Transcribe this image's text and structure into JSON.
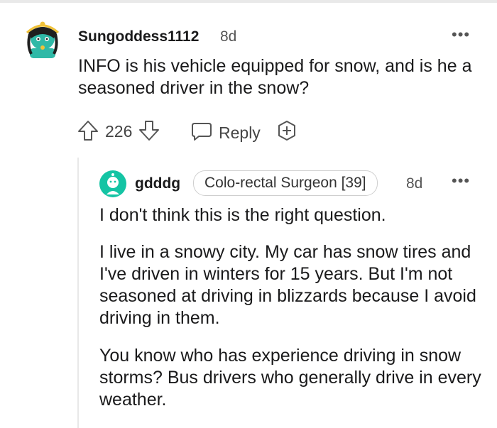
{
  "parent_comment": {
    "username": "Sungoddess1112",
    "time": "8d",
    "more_label": "•••",
    "body": "INFO is his vehicle equipped for snow, and is he a seasoned driver in the snow?",
    "votes": "226",
    "reply_label": "Reply",
    "icons": [
      "upvote-icon",
      "downvote-icon",
      "comment-icon",
      "award-icon"
    ]
  },
  "reply_comment": {
    "username": "gdddg",
    "flair": "Colo-rectal Surgeon [39]",
    "time": "8d",
    "more_label": "•••",
    "paragraphs": [
      "I don't think this is the right question.",
      "I live in a snowy city. My car has snow tires and I've driven in winters for 15 years. But I'm not seasoned at driving in blizzards because I avoid driving in them.",
      "You know who has experience driving in snow storms? Bus drivers who generally drive in every weather."
    ]
  },
  "colors": {
    "text": "#1a1a1b",
    "meta": "#555555",
    "avatar_teal": "#2fb9a7",
    "avatar_gold": "#f0c23a",
    "reply_avatar": "#14c4a4"
  }
}
